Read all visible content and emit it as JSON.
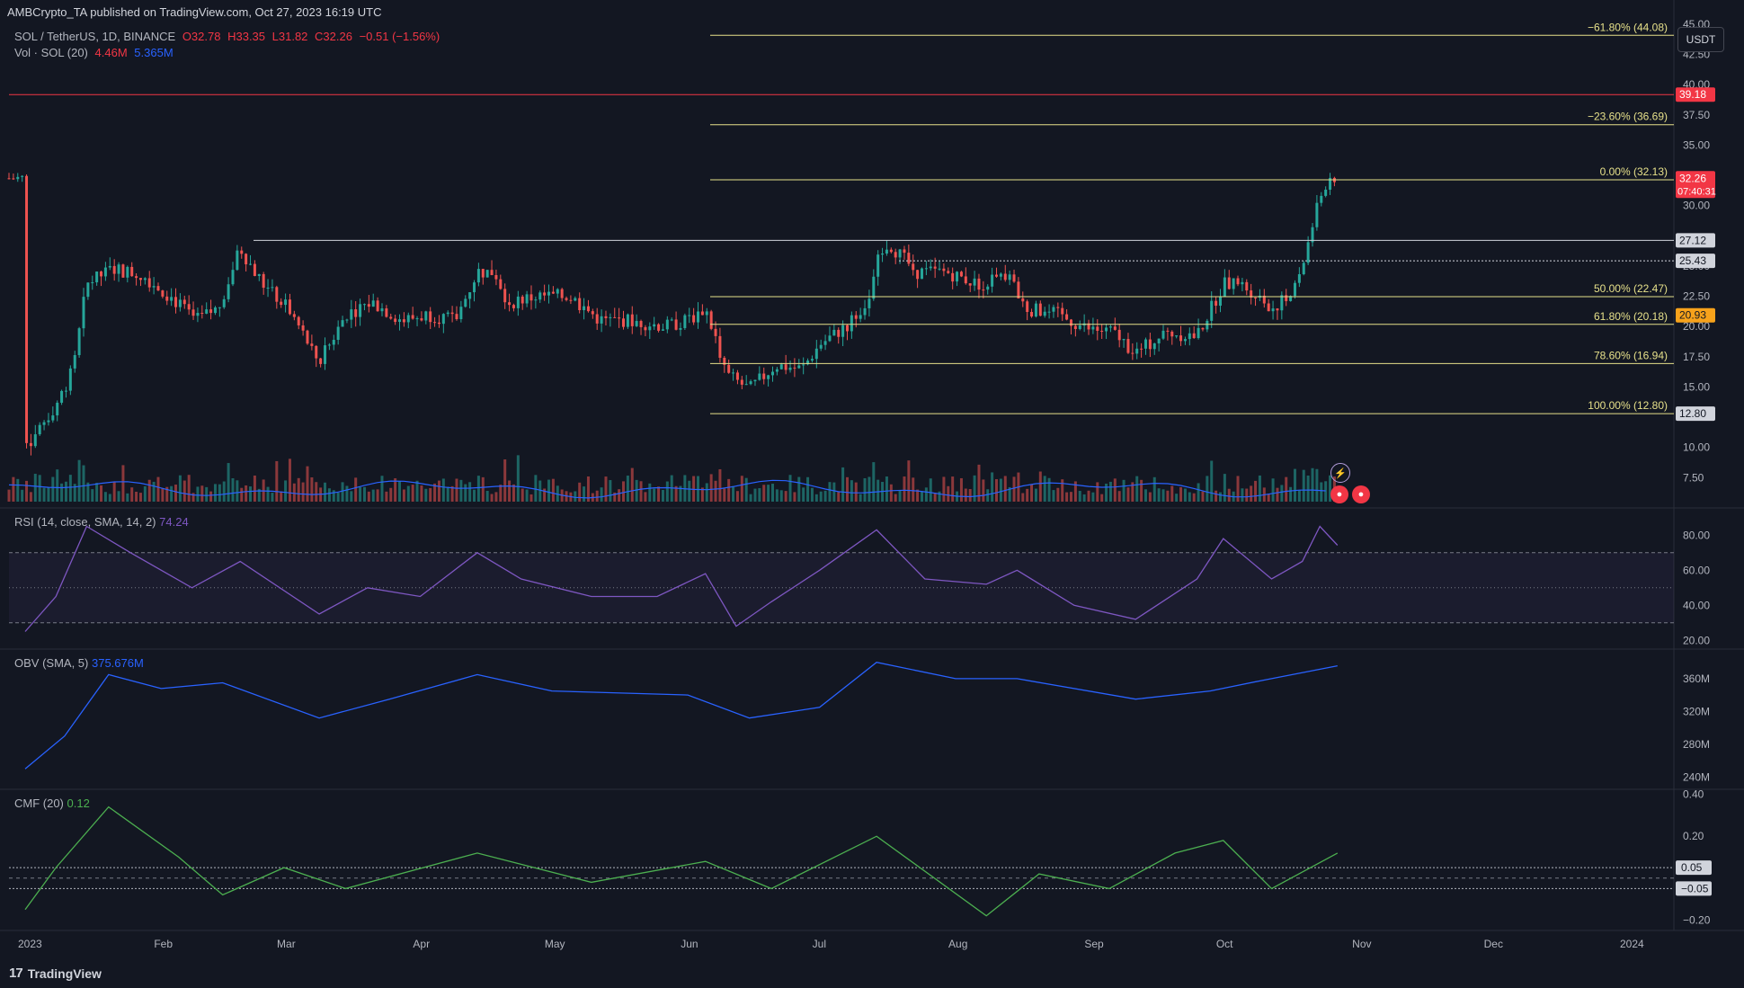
{
  "published": "AMBCrypto_TA published on TradingView.com, Oct 27, 2023 16:19 UTC",
  "symbol": {
    "title": "SOL / TetherUS, 1D, BINANCE",
    "open": "O32.78",
    "high": "H33.35",
    "low": "L31.82",
    "close": "C32.26",
    "change": "−0.51 (−1.56%)"
  },
  "volume_legend": {
    "label": "Vol · SOL (20)",
    "v1": "4.46M",
    "v2": "5.365M"
  },
  "currency_button": "USDT",
  "brand": {
    "label": "TradingView",
    "mark": "17"
  },
  "colors": {
    "background": "#131722",
    "up": "#26a69a",
    "down": "#ef5350",
    "fib": "#e6e08a",
    "resistance": "#f23645",
    "rsi": "#7e57c2",
    "obv": "#2962ff",
    "cmf": "#4caf50"
  },
  "chart_data": [
    {
      "type": "line",
      "description": "price",
      "title": "SOL / TetherUS, 1D, BINANCE",
      "ylim": [
        5,
        47
      ],
      "y_ticks": [
        "45.00",
        "42.50",
        "40.00",
        "37.50",
        "35.00",
        "30.00",
        "25.00",
        "22.50",
        "20.00",
        "17.50",
        "15.00",
        "10.00",
        "7.50"
      ],
      "x_ticks": [
        "2023",
        "Feb",
        "Mar",
        "Apr",
        "May",
        "Jun",
        "Jul",
        "Aug",
        "Sep",
        "Oct",
        "Nov",
        "Dec",
        "2024"
      ],
      "close_points": [
        {
          "x": "2023-01-01",
          "y": 10.0
        },
        {
          "x": "2023-01-08",
          "y": 13.5
        },
        {
          "x": "2023-01-12",
          "y": 16.5
        },
        {
          "x": "2023-01-15",
          "y": 23.5
        },
        {
          "x": "2023-01-21",
          "y": 24.8
        },
        {
          "x": "2023-01-28",
          "y": 24.2
        },
        {
          "x": "2023-02-03",
          "y": 22.5
        },
        {
          "x": "2023-02-09",
          "y": 20.5
        },
        {
          "x": "2023-02-14",
          "y": 21.5
        },
        {
          "x": "2023-02-19",
          "y": 26.5
        },
        {
          "x": "2023-02-24",
          "y": 23.5
        },
        {
          "x": "2023-03-02",
          "y": 21.5
        },
        {
          "x": "2023-03-09",
          "y": 17.0
        },
        {
          "x": "2023-03-15",
          "y": 21.0
        },
        {
          "x": "2023-03-21",
          "y": 22.0
        },
        {
          "x": "2023-03-28",
          "y": 20.5
        },
        {
          "x": "2023-04-03",
          "y": 21.0
        },
        {
          "x": "2023-04-09",
          "y": 20.5
        },
        {
          "x": "2023-04-14",
          "y": 24.5
        },
        {
          "x": "2023-04-18",
          "y": 24.5
        },
        {
          "x": "2023-04-21",
          "y": 22.0
        },
        {
          "x": "2023-04-28",
          "y": 22.5
        },
        {
          "x": "2023-05-05",
          "y": 22.5
        },
        {
          "x": "2023-05-12",
          "y": 20.5
        },
        {
          "x": "2023-05-19",
          "y": 20.5
        },
        {
          "x": "2023-05-27",
          "y": 20.0
        },
        {
          "x": "2023-06-01",
          "y": 20.5
        },
        {
          "x": "2023-06-05",
          "y": 21.5
        },
        {
          "x": "2023-06-10",
          "y": 16.0
        },
        {
          "x": "2023-06-15",
          "y": 14.8
        },
        {
          "x": "2023-06-21",
          "y": 16.8
        },
        {
          "x": "2023-06-27",
          "y": 16.5
        },
        {
          "x": "2023-07-01",
          "y": 18.5
        },
        {
          "x": "2023-07-07",
          "y": 20.0
        },
        {
          "x": "2023-07-13",
          "y": 22.5
        },
        {
          "x": "2023-07-14",
          "y": 26.5
        },
        {
          "x": "2023-07-17",
          "y": 26.8
        },
        {
          "x": "2023-07-23",
          "y": 24.5
        },
        {
          "x": "2023-07-30",
          "y": 24.5
        },
        {
          "x": "2023-08-06",
          "y": 23.5
        },
        {
          "x": "2023-08-13",
          "y": 24.2
        },
        {
          "x": "2023-08-17",
          "y": 21.5
        },
        {
          "x": "2023-08-24",
          "y": 21.0
        },
        {
          "x": "2023-08-31",
          "y": 19.8
        },
        {
          "x": "2023-09-06",
          "y": 19.5
        },
        {
          "x": "2023-09-11",
          "y": 17.8
        },
        {
          "x": "2023-09-18",
          "y": 19.5
        },
        {
          "x": "2023-09-25",
          "y": 19.2
        },
        {
          "x": "2023-10-01",
          "y": 23.5
        },
        {
          "x": "2023-10-05",
          "y": 23.5
        },
        {
          "x": "2023-10-09",
          "y": 22.5
        },
        {
          "x": "2023-10-12",
          "y": 21.5
        },
        {
          "x": "2023-10-16",
          "y": 22.5
        },
        {
          "x": "2023-10-19",
          "y": 25.0
        },
        {
          "x": "2023-10-21",
          "y": 28.0
        },
        {
          "x": "2023-10-23",
          "y": 30.5
        },
        {
          "x": "2023-10-25",
          "y": 32.5
        },
        {
          "x": "2023-10-27",
          "y": 32.26
        }
      ],
      "horizontal_levels": [
        {
          "label": "−61.80% (44.08)",
          "value": 44.08,
          "kind": "fib"
        },
        {
          "label": "−23.60% (36.69)",
          "value": 36.69,
          "kind": "fib"
        },
        {
          "label": "0.00% (32.13)",
          "value": 32.13,
          "kind": "fib"
        },
        {
          "label": "50.00% (22.47)",
          "value": 22.47,
          "kind": "fib"
        },
        {
          "label": "61.80% (20.18)",
          "value": 20.18,
          "kind": "fib"
        },
        {
          "label": "78.60% (16.94)",
          "value": 16.94,
          "kind": "fib"
        },
        {
          "label": "100.00% (12.80)",
          "value": 12.8,
          "kind": "fib"
        },
        {
          "label": "",
          "value": 39.18,
          "kind": "resistance"
        },
        {
          "label": "",
          "value": 27.12,
          "kind": "level"
        },
        {
          "label": "",
          "value": 25.43,
          "kind": "level-dotted"
        }
      ],
      "price_tags": [
        {
          "text": "39.18",
          "value": 39.18,
          "style": "red"
        },
        {
          "text": "32.26",
          "value": 32.26,
          "style": "red",
          "extra": "07:40:31"
        },
        {
          "text": "27.12",
          "value": 27.12,
          "style": "white"
        },
        {
          "text": "25.43",
          "value": 25.43,
          "style": "white"
        },
        {
          "text": "20.93",
          "value": 20.93,
          "style": "orange"
        },
        {
          "text": "12.80",
          "value": 12.8,
          "style": "white"
        }
      ]
    },
    {
      "type": "line",
      "description": "rsi",
      "legend": "RSI (14, close, SMA, 14, 2)",
      "last": "74.24",
      "ylim": [
        15,
        95
      ],
      "y_ticks": [
        "80.00",
        "60.00",
        "40.00",
        "20.00"
      ],
      "bands": [
        70,
        50,
        30
      ],
      "points": [
        {
          "x": "2023-01-01",
          "y": 25
        },
        {
          "x": "2023-01-08",
          "y": 45
        },
        {
          "x": "2023-01-15",
          "y": 85
        },
        {
          "x": "2023-01-25",
          "y": 70
        },
        {
          "x": "2023-02-08",
          "y": 50
        },
        {
          "x": "2023-02-19",
          "y": 65
        },
        {
          "x": "2023-03-09",
          "y": 35
        },
        {
          "x": "2023-03-20",
          "y": 50
        },
        {
          "x": "2023-04-01",
          "y": 45
        },
        {
          "x": "2023-04-14",
          "y": 70
        },
        {
          "x": "2023-04-24",
          "y": 55
        },
        {
          "x": "2023-05-10",
          "y": 45
        },
        {
          "x": "2023-05-25",
          "y": 45
        },
        {
          "x": "2023-06-05",
          "y": 58
        },
        {
          "x": "2023-06-12",
          "y": 28
        },
        {
          "x": "2023-06-20",
          "y": 42
        },
        {
          "x": "2023-07-01",
          "y": 60
        },
        {
          "x": "2023-07-14",
          "y": 83
        },
        {
          "x": "2023-07-25",
          "y": 55
        },
        {
          "x": "2023-08-08",
          "y": 52
        },
        {
          "x": "2023-08-15",
          "y": 60
        },
        {
          "x": "2023-08-28",
          "y": 40
        },
        {
          "x": "2023-09-11",
          "y": 32
        },
        {
          "x": "2023-09-25",
          "y": 55
        },
        {
          "x": "2023-10-01",
          "y": 78
        },
        {
          "x": "2023-10-12",
          "y": 55
        },
        {
          "x": "2023-10-19",
          "y": 65
        },
        {
          "x": "2023-10-23",
          "y": 85
        },
        {
          "x": "2023-10-27",
          "y": 74.24
        }
      ]
    },
    {
      "type": "line",
      "description": "obv",
      "legend": "OBV (SMA, 5)",
      "last": "375.676M",
      "ylim": [
        225,
        395
      ],
      "y_ticks": [
        "360M",
        "320M",
        "280M",
        "240M"
      ],
      "points": [
        {
          "x": "2023-01-01",
          "y": 250
        },
        {
          "x": "2023-01-10",
          "y": 290
        },
        {
          "x": "2023-01-20",
          "y": 365
        },
        {
          "x": "2023-02-01",
          "y": 348
        },
        {
          "x": "2023-02-15",
          "y": 355
        },
        {
          "x": "2023-03-09",
          "y": 312
        },
        {
          "x": "2023-03-25",
          "y": 335
        },
        {
          "x": "2023-04-14",
          "y": 365
        },
        {
          "x": "2023-05-01",
          "y": 345
        },
        {
          "x": "2023-06-01",
          "y": 340
        },
        {
          "x": "2023-06-15",
          "y": 312
        },
        {
          "x": "2023-07-01",
          "y": 325
        },
        {
          "x": "2023-07-14",
          "y": 380
        },
        {
          "x": "2023-08-01",
          "y": 360
        },
        {
          "x": "2023-08-15",
          "y": 360
        },
        {
          "x": "2023-09-11",
          "y": 335
        },
        {
          "x": "2023-09-28",
          "y": 345
        },
        {
          "x": "2023-10-10",
          "y": 358
        },
        {
          "x": "2023-10-27",
          "y": 375.676
        }
      ]
    },
    {
      "type": "line",
      "description": "cmf",
      "legend": "CMF (20)",
      "last": "0.12",
      "ylim": [
        -0.25,
        0.42
      ],
      "y_ticks": [
        "0.40",
        "0.20",
        "−0.20"
      ],
      "bands": [
        0.05,
        -0.05
      ],
      "band_tags": [
        "0.05",
        "−0.05"
      ],
      "points": [
        {
          "x": "2023-01-01",
          "y": -0.15
        },
        {
          "x": "2023-01-08",
          "y": 0.05
        },
        {
          "x": "2023-01-20",
          "y": 0.34
        },
        {
          "x": "2023-02-05",
          "y": 0.1
        },
        {
          "x": "2023-02-15",
          "y": -0.08
        },
        {
          "x": "2023-03-01",
          "y": 0.05
        },
        {
          "x": "2023-03-15",
          "y": -0.05
        },
        {
          "x": "2023-04-14",
          "y": 0.12
        },
        {
          "x": "2023-05-10",
          "y": -0.02
        },
        {
          "x": "2023-06-05",
          "y": 0.08
        },
        {
          "x": "2023-06-20",
          "y": -0.05
        },
        {
          "x": "2023-07-14",
          "y": 0.2
        },
        {
          "x": "2023-08-08",
          "y": -0.18
        },
        {
          "x": "2023-08-20",
          "y": 0.02
        },
        {
          "x": "2023-09-05",
          "y": -0.05
        },
        {
          "x": "2023-09-20",
          "y": 0.12
        },
        {
          "x": "2023-10-01",
          "y": 0.18
        },
        {
          "x": "2023-10-12",
          "y": -0.05
        },
        {
          "x": "2023-10-27",
          "y": 0.12
        }
      ]
    }
  ]
}
